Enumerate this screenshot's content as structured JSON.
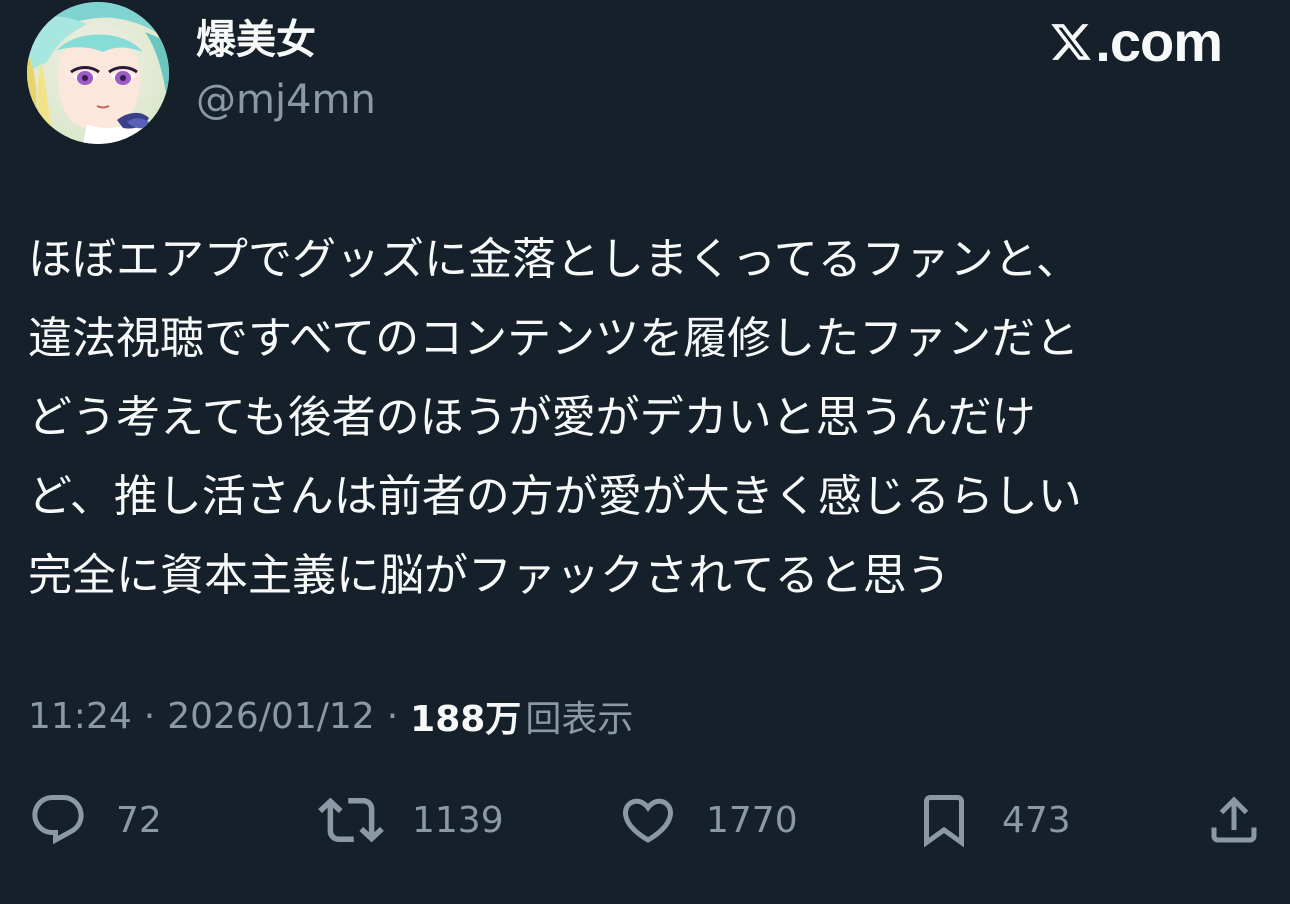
{
  "author": {
    "display_name": "爆美女",
    "handle": "@mj4mn",
    "avatar_icon": "anime-avatar-icon"
  },
  "brand": {
    "text": ".com",
    "icon": "x-logo-icon"
  },
  "tweet": {
    "lines": [
      "ほぼエアプでグッズに金落としまくってるファンと、",
      "違法視聴ですべてのコンテンツを履修したファンだと",
      "どう考えても後者のほうが愛がデカいと思うんだけ",
      "ど、推し活さんは前者の方が愛が大きく感じるらしい",
      "完全に資本主義に脳がファックされてると思う"
    ]
  },
  "meta": {
    "time": "11:24",
    "separator": "·",
    "date": "2026/01/12",
    "views_count": "188万",
    "views_label": "回表示"
  },
  "actions": {
    "reply": {
      "icon": "reply-icon",
      "count": "72"
    },
    "retweet": {
      "icon": "retweet-icon",
      "count": "1139"
    },
    "like": {
      "icon": "heart-icon",
      "count": "1770"
    },
    "bookmark": {
      "icon": "bookmark-icon",
      "count": "473"
    },
    "share": {
      "icon": "share-icon"
    }
  },
  "colors": {
    "background": "#15202b",
    "text_primary": "#f7f9f9",
    "text_secondary": "#8b98a5"
  }
}
